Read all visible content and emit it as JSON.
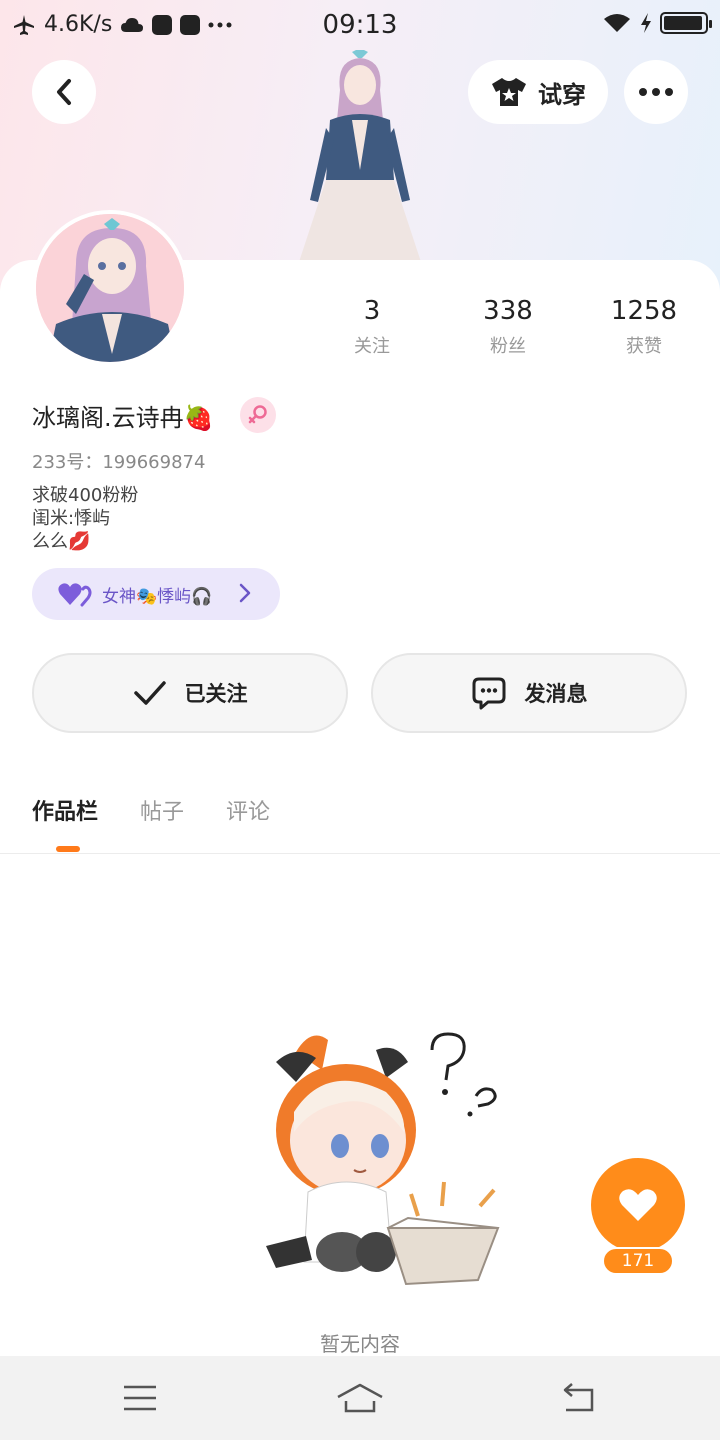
{
  "status_bar": {
    "network_speed": "4.6K/s",
    "time": "09:13",
    "icons": [
      "airplane-icon",
      "cloud-icon",
      "music-app-icon",
      "mail-app-icon",
      "more-dots-icon",
      "wifi-icon",
      "charging-icon",
      "battery-icon"
    ]
  },
  "header": {
    "try_on_label": "试穿",
    "icons": {
      "back": "chevron-left-icon",
      "try_on": "tshirt-icon",
      "more": "more-icon"
    }
  },
  "profile": {
    "stats": [
      {
        "value": "3",
        "label": "关注"
      },
      {
        "value": "338",
        "label": "粉丝"
      },
      {
        "value": "1258",
        "label": "获赞"
      }
    ],
    "username": "冰璃阁.云诗冉🍓",
    "gender": "female",
    "uid": "233号：199669874",
    "bio": [
      "求破400粉粉",
      "闺米:悸屿",
      "么么💋"
    ],
    "relation_tag": "女神🎭悸屿🎧"
  },
  "actions": {
    "follow_label": "已关注",
    "message_label": "发消息"
  },
  "tabs": [
    {
      "label": "作品栏",
      "active": true
    },
    {
      "label": "帖子",
      "active": false
    },
    {
      "label": "评论",
      "active": false
    }
  ],
  "empty_state": {
    "text": "暂无内容"
  },
  "like": {
    "count": "171"
  },
  "colors": {
    "accent": "#ff8c1a",
    "tag_bg": "#ebe7fb",
    "tag_text": "#6a55c7",
    "gender_bg": "#fde0e8"
  }
}
